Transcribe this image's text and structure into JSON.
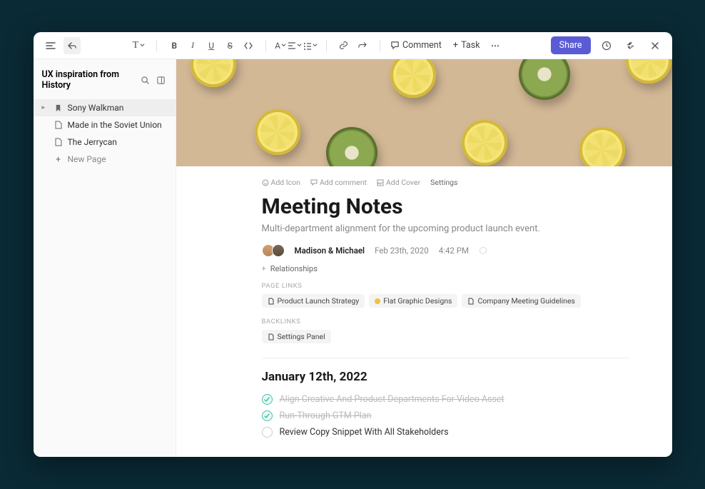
{
  "toolbar": {
    "comment": "Comment",
    "task": "Task",
    "share": "Share"
  },
  "sidebar": {
    "title": "UX inspiration from History",
    "items": [
      {
        "label": "Sony Walkman",
        "icon": "bookmark"
      },
      {
        "label": "Made in the Soviet Union",
        "icon": "page"
      },
      {
        "label": "The Jerrycan",
        "icon": "page"
      }
    ],
    "new_page": "New Page"
  },
  "doc": {
    "actions": {
      "add_icon": "Add Icon",
      "add_comment": "Add comment",
      "add_cover": "Add Cover",
      "settings": "Settings"
    },
    "title": "Meeting Notes",
    "subtitle": "Multi-department alignment for the upcoming product launch event.",
    "authors": "Madison & Michael",
    "date": "Feb 23th, 2020",
    "time": "4:42 PM",
    "relationships": "Relationships",
    "page_links_label": "PAGE LINKS",
    "page_links": [
      {
        "label": "Product Launch Strategy",
        "icon": "page"
      },
      {
        "label": "Flat Graphic Designs",
        "icon": "dot"
      },
      {
        "label": "Company Meeting Guidelines",
        "icon": "page"
      }
    ],
    "backlinks_label": "BACKLINKS",
    "backlinks": [
      {
        "label": "Settings Panel",
        "icon": "page"
      }
    ],
    "heading": "January 12th, 2022",
    "tasks": [
      {
        "text": "Align Creative And Product Departments For Video Asset",
        "done": true
      },
      {
        "text": "Run-Through GTM Plan",
        "done": true
      },
      {
        "text": "Review Copy Snippet With All Stakeholders",
        "done": false
      }
    ]
  }
}
